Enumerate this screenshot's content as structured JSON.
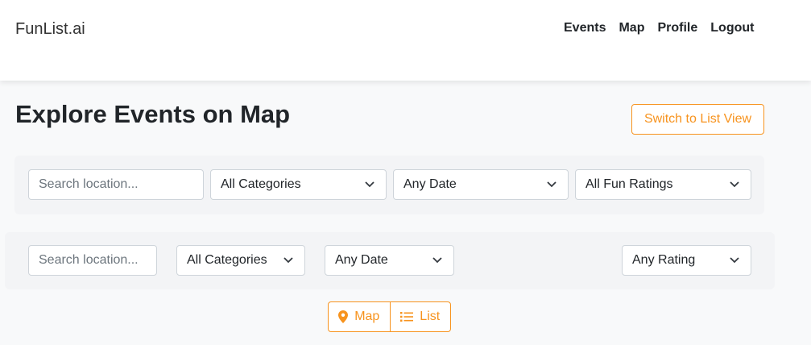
{
  "navbar": {
    "brand": "FunList.ai",
    "links": [
      "Events",
      "Map",
      "Profile",
      "Logout"
    ]
  },
  "page": {
    "title": "Explore Events on Map",
    "switch_button": "Switch to List View"
  },
  "filters_primary": {
    "search_placeholder": "Search location...",
    "category": "All Categories",
    "date": "Any Date",
    "rating": "All Fun Ratings"
  },
  "filters_secondary": {
    "search_placeholder": "Search location...",
    "category": "All Categories",
    "date": "Any Date",
    "rating": "Any Rating"
  },
  "view_toggle": {
    "map_label": "Map",
    "map_icon": "map-marker-icon",
    "list_label": "List",
    "list_icon": "list-icon"
  },
  "colors": {
    "accent": "#f7931e",
    "background": "#f8f9fa",
    "card": "#f3f4f6",
    "border": "#ced4da"
  }
}
